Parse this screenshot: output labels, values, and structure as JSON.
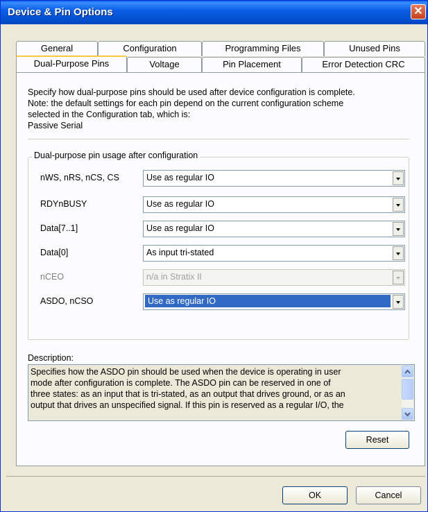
{
  "window": {
    "title": "Device & Pin Options"
  },
  "tabs_row1": [
    "General",
    "Configuration",
    "Programming Files",
    "Unused Pins"
  ],
  "tabs_row2": [
    "Dual-Purpose Pins",
    "Voltage",
    "Pin Placement",
    "Error Detection CRC"
  ],
  "active_tab": "Dual-Purpose Pins",
  "intro": {
    "line1": "Specify how dual-purpose pins should be used after device configuration is complete.",
    "line2": "Note: the default settings for each pin depend on the current configuration scheme",
    "line3": "selected in the Configuration tab, which is:",
    "scheme": "Passive Serial"
  },
  "group": {
    "label": "Dual-purpose pin usage after configuration",
    "rows": [
      {
        "label": "nWS, nRS, nCS, CS",
        "value": "Use as regular IO",
        "enabled": true
      },
      {
        "label": "RDYnBUSY",
        "value": "Use as regular IO",
        "enabled": true
      },
      {
        "label": "Data[7..1]",
        "value": "Use as regular IO",
        "enabled": true
      },
      {
        "label": "Data[0]",
        "value": "As input tri-stated",
        "enabled": true
      },
      {
        "label": "nCEO",
        "value": "n/a in Stratix II",
        "enabled": false
      },
      {
        "label": "ASDO, nCSO",
        "value": "Use as regular IO",
        "enabled": true,
        "selected": true
      }
    ]
  },
  "description": {
    "label": "Description:",
    "line1": "Specifies how the ASDO pin should be used when the device is operating in user",
    "line2": "mode after configuration is complete. The ASDO pin can be reserved in one of",
    "line3": "three states: as an input that is tri-stated, as an output that drives ground, or as an",
    "line4": "output that drives an unspecified signal. If this pin is reserved as a regular I/O, the"
  },
  "buttons": {
    "reset": "Reset",
    "ok": "OK",
    "cancel": "Cancel"
  },
  "colors": {
    "title_bar": "#0553d4",
    "selection": "#316ac5",
    "tab_highlight": "#ffc83c"
  }
}
